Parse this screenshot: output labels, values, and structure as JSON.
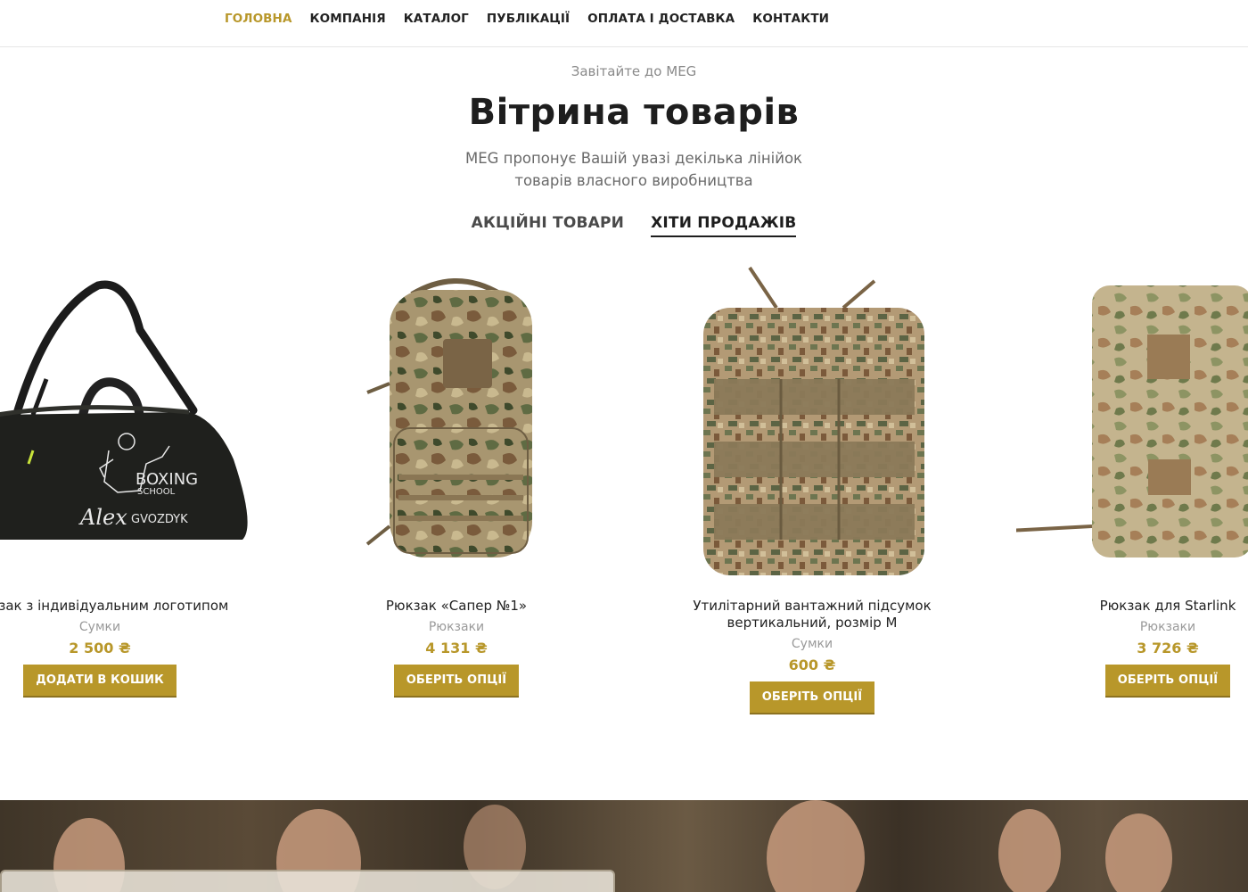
{
  "nav": {
    "items": [
      {
        "label": "ГОЛОВНА",
        "active": true
      },
      {
        "label": "КОМПАНІЯ",
        "active": false
      },
      {
        "label": "КАТАЛОГ",
        "active": false
      },
      {
        "label": "ПУБЛІКАЦІЇ",
        "active": false
      },
      {
        "label": "ОПЛАТА І ДОСТАВКА",
        "active": false
      },
      {
        "label": "КОНТАКТИ",
        "active": false
      }
    ]
  },
  "hero": {
    "eyebrow": "Завітайте до MEG",
    "title": "Вітрина товарів",
    "subtitle_line1": "MEG пропонує Вашій увазі декілька лінійок",
    "subtitle_line2": "товарів власного виробництва"
  },
  "tabs": [
    {
      "label": "АКЦІЙНІ ТОВАРИ",
      "active": false
    },
    {
      "label": "ХІТИ ПРОДАЖІВ",
      "active": true
    }
  ],
  "products": [
    {
      "name_line1": "Рюкзак з індивідуальним логотипом",
      "name_line2": "",
      "category": "Сумки",
      "price": "2 500 ₴",
      "button": "ДОДАТИ В КОШИК",
      "image": "black-duffel-bag",
      "bag_text_1": "BOXING",
      "bag_text_2": "SCHOOL",
      "bag_text_3": "Alex",
      "bag_text_4": "GVOZDYK"
    },
    {
      "name_line1": "Рюкзак «Сапер №1»",
      "name_line2": "",
      "category": "Рюкзаки",
      "price": "4 131 ₴",
      "button": "ОБЕРІТЬ ОПЦІЇ",
      "image": "camo-backpack"
    },
    {
      "name_line1": "Утилітарний вантажний підсумок",
      "name_line2": "вертикальний, розмір М",
      "category": "Сумки",
      "price": "600 ₴",
      "button": "ОБЕРІТЬ ОПЦІЇ",
      "image": "pixel-camo-pouch"
    },
    {
      "name_line1": "Рюкзак для Starlink",
      "name_line2": "",
      "category": "Рюкзаки",
      "price": "3 726 ₴",
      "button": "ОБЕРІТЬ ОПЦІЇ",
      "image": "camo-starlink-backpack"
    }
  ],
  "colors": {
    "accent": "#b8972a",
    "text": "#1e1e1e",
    "muted": "#9a9a9a"
  }
}
